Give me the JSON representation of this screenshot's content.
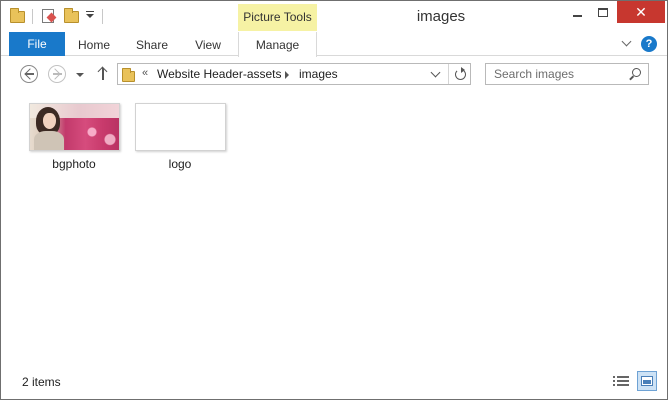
{
  "window": {
    "title": "images",
    "close_glyph": "✕"
  },
  "quick_access_toolbar": {
    "icons": [
      "folder-icon",
      "properties-icon",
      "new-folder-icon",
      "customize-dropdown-icon"
    ]
  },
  "ribbon": {
    "contextual_group_label": "Picture Tools",
    "tabs": {
      "file": "File",
      "home": "Home",
      "share": "Share",
      "view": "View",
      "manage": "Manage"
    },
    "help_glyph": "?"
  },
  "address_bar": {
    "chevrons": "«",
    "breadcrumbs": [
      "Website Header-assets",
      "images"
    ]
  },
  "search": {
    "placeholder": "Search images"
  },
  "files": [
    {
      "name": "bgphoto",
      "kind": "photo"
    },
    {
      "name": "logo",
      "kind": "blank-image"
    }
  ],
  "status_bar": {
    "item_count": "2 items",
    "active_view": "large-icons"
  },
  "colors": {
    "file_tab": "#1979ca",
    "contextual_tab": "#f6f2a4",
    "close_button": "#c7372f"
  }
}
